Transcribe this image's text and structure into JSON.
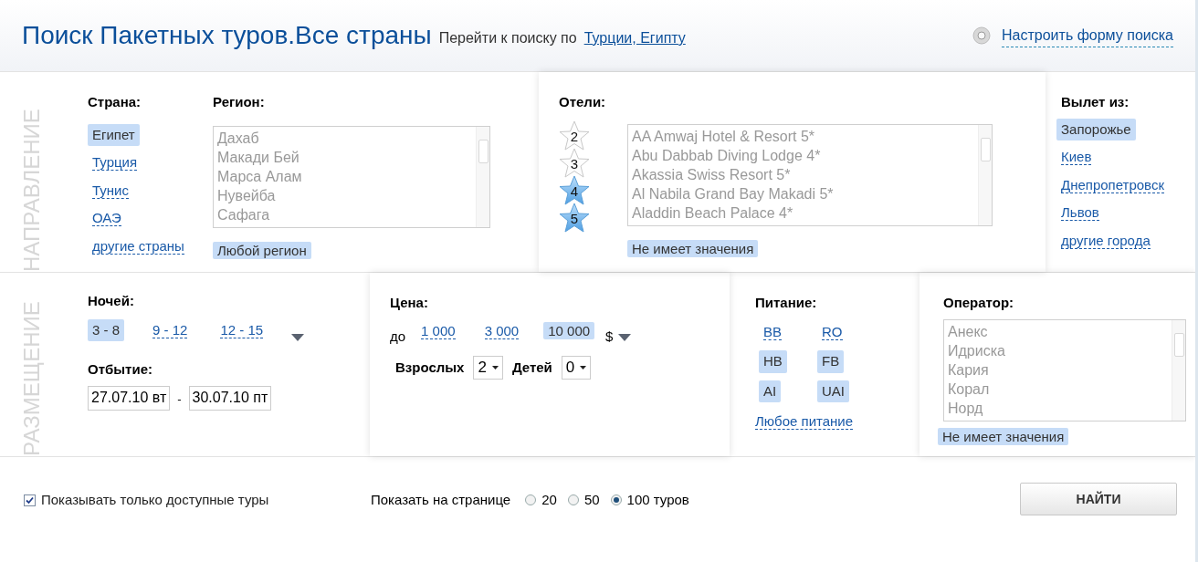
{
  "header": {
    "title": "Поиск Пакетных туров.Все страны",
    "goto_label": "Перейти к поиску по",
    "goto_link": "Турции, Египту",
    "settings_link": "Настроить форму поиска"
  },
  "direction": {
    "section_label": "НАПРАВЛЕНИЕ",
    "country": {
      "label": "Страна:",
      "items": [
        {
          "label": "Египет",
          "selected": true
        },
        {
          "label": "Турция",
          "selected": false
        },
        {
          "label": "Тунис",
          "selected": false
        },
        {
          "label": "ОАЭ",
          "selected": false
        },
        {
          "label": "другие страны",
          "selected": false
        }
      ]
    },
    "region": {
      "label": "Регион:",
      "options": [
        "Дахаб",
        "Макади Бей",
        "Марса Алам",
        "Нувейба",
        "Сафага"
      ],
      "any": {
        "label": "Любой регион",
        "selected": true
      }
    },
    "hotels": {
      "label": "Отели:",
      "stars": [
        {
          "label": "2",
          "selected": false
        },
        {
          "label": "3",
          "selected": false
        },
        {
          "label": "4",
          "selected": true
        },
        {
          "label": "5",
          "selected": true
        }
      ],
      "options": [
        "AA Amwaj Hotel & Resort 5*",
        "Abu Dabbab Diving Lodge 4*",
        "Akassia Swiss Resort 5*",
        "Al Nabila Grand Bay Makadi 5*",
        "Aladdin Beach Palace 4*"
      ],
      "any": {
        "label": "Не имеет значения",
        "selected": true
      }
    },
    "departure": {
      "label": "Вылет из:",
      "items": [
        {
          "label": "Запорожье",
          "selected": true
        },
        {
          "label": "Киев",
          "selected": false
        },
        {
          "label": "Днепропетровск",
          "selected": false
        },
        {
          "label": "Львов",
          "selected": false
        },
        {
          "label": "другие города",
          "selected": false
        }
      ]
    }
  },
  "accommodation": {
    "section_label": "РАЗМЕЩЕНИЕ",
    "nights": {
      "label": "Ночей:",
      "items": [
        {
          "label": "3 - 8",
          "selected": true
        },
        {
          "label": "9 - 12",
          "selected": false
        },
        {
          "label": "12 - 15",
          "selected": false
        }
      ]
    },
    "dates": {
      "label": "Отбытие:",
      "from": "27.07.10 вт",
      "separator": "-",
      "to": "30.07.10 пт"
    },
    "price": {
      "label": "Цена:",
      "prefix": "до",
      "items": [
        {
          "label": "1 000",
          "selected": false
        },
        {
          "label": "3 000",
          "selected": false
        },
        {
          "label": "10 000",
          "selected": true
        }
      ],
      "currency": "$"
    },
    "adults": {
      "label": "Взрослых",
      "value": "2"
    },
    "children": {
      "label": "Детей",
      "value": "0"
    },
    "food": {
      "label": "Питание:",
      "items": [
        {
          "label": "BB",
          "selected": false
        },
        {
          "label": "RO",
          "selected": false
        },
        {
          "label": "HB",
          "selected": true
        },
        {
          "label": "FB",
          "selected": true
        },
        {
          "label": "AI",
          "selected": true
        },
        {
          "label": "UAI",
          "selected": true
        }
      ],
      "any": {
        "label": "Любое питание",
        "selected": false
      }
    },
    "operator": {
      "label": "Оператор:",
      "options": [
        "Анекс",
        "Идриска",
        "Кария",
        "Корал",
        "Норд"
      ],
      "any": {
        "label": "Не имеет значения",
        "selected": true
      }
    }
  },
  "footer": {
    "available_only": {
      "label": "Показывать только доступные туры",
      "checked": true
    },
    "per_page": {
      "label": "Показать на странице",
      "options": [
        {
          "label": "20",
          "selected": false
        },
        {
          "label": "50",
          "selected": false
        },
        {
          "label": "100 туров",
          "selected": true
        }
      ]
    },
    "search_button": "НАЙТИ"
  }
}
